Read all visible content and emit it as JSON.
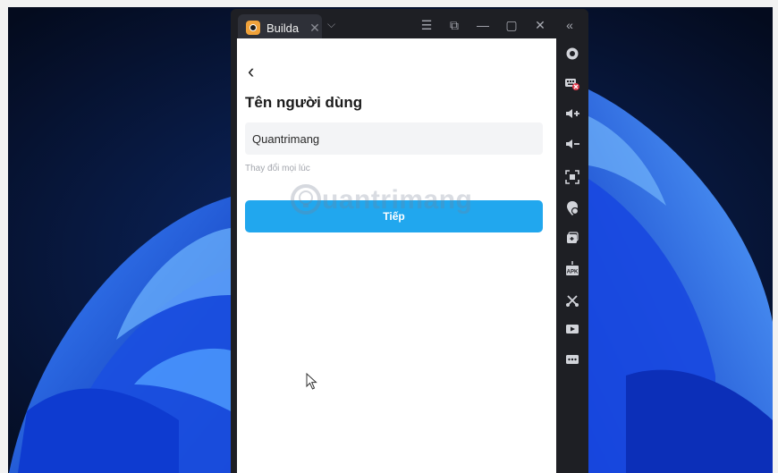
{
  "window": {
    "tab_title": "Builda",
    "tab_close": "✕",
    "tab_dropdown": "⌵",
    "controls": [
      "☰",
      "⧉",
      "—",
      "▢",
      "✕",
      "«"
    ]
  },
  "screen": {
    "back_symbol": "‹",
    "title": "Tên người dùng",
    "username_value": "Quantrimang",
    "hint": "Thay đổi mọi lúc",
    "next_button": "Tiếp",
    "watermark": "uantrimang"
  },
  "sidebar": {
    "icons": [
      "settings-icon",
      "keyboard-icon",
      "volume-up-icon",
      "volume-down-icon",
      "screenshot-frame-icon",
      "location-icon",
      "multi-instance-icon",
      "apk-install-icon",
      "scissors-icon",
      "record-icon",
      "more-icon"
    ],
    "apk_label": "APK"
  },
  "colors": {
    "accent": "#21a7ee",
    "window_bg": "#1e1f24",
    "tab_icon": "#f0a23a"
  }
}
